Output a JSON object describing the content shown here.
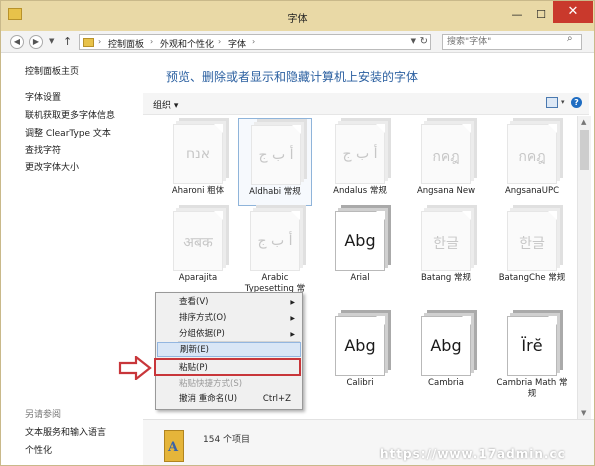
{
  "window": {
    "title": "字体",
    "controls": {
      "minimize": "—",
      "maximize": "☐",
      "close": "✕"
    }
  },
  "address": {
    "crumbs": [
      "控制面板",
      "外观和个性化",
      "字体"
    ],
    "separator": "›",
    "search_placeholder": "搜索\"字体\""
  },
  "sidebar": {
    "home": "控制面板主页",
    "links": [
      "字体设置",
      "联机获取更多字体信息",
      "调整 ClearType 文本",
      "查找字符",
      "更改字体大小"
    ],
    "see_also_title": "另请参阅",
    "see_also": [
      "文本服务和输入语言",
      "个性化"
    ]
  },
  "main": {
    "heading": "预览、删除或者显示和隐藏计算机上安装的字体",
    "organize": "组织",
    "fonts": [
      {
        "name": "Aharoni 粗体",
        "sample": "אנח",
        "style": "light",
        "selected": false
      },
      {
        "name": "Aldhabi 常规",
        "sample": "أ ب ج",
        "style": "light",
        "selected": true
      },
      {
        "name": "Andalus 常规",
        "sample": "أ ب ج",
        "style": "light",
        "selected": false
      },
      {
        "name": "Angsana New",
        "sample": "กคฎ",
        "style": "light",
        "selected": false
      },
      {
        "name": "AngsanaUPC",
        "sample": "กคฎ",
        "style": "light",
        "selected": false
      },
      {
        "name": "Aparajita",
        "sample": "अबक",
        "style": "light",
        "selected": false
      },
      {
        "name": "Arabic Typesetting 常",
        "sample": "أ ب ج",
        "style": "light",
        "selected": false
      },
      {
        "name": "Arial",
        "sample": "Abg",
        "style": "dark",
        "selected": false
      },
      {
        "name": "Batang 常规",
        "sample": "한글",
        "style": "light",
        "selected": false
      },
      {
        "name": "BatangChe 常规",
        "sample": "한글",
        "style": "light",
        "selected": false
      },
      {
        "name": "Calibri",
        "sample": "Abg",
        "style": "dark",
        "selected": false
      },
      {
        "name": "Cambria",
        "sample": "Abg",
        "style": "dark",
        "selected": false
      },
      {
        "name": "Cambria Math 常规",
        "sample": "Ïrĕ",
        "style": "dark",
        "selected": false
      }
    ]
  },
  "context_menu": {
    "items": [
      {
        "label": "查看(V)",
        "submenu": true,
        "highlight": false,
        "disabled": false,
        "shortcut": ""
      },
      {
        "label": "排序方式(O)",
        "submenu": true,
        "highlight": false,
        "disabled": false,
        "shortcut": ""
      },
      {
        "label": "分组依据(P)",
        "submenu": true,
        "highlight": false,
        "disabled": false,
        "shortcut": ""
      },
      {
        "label": "刷新(E)",
        "submenu": false,
        "highlight": true,
        "disabled": false,
        "shortcut": ""
      },
      {
        "label": "粘贴(P)",
        "submenu": false,
        "highlight": false,
        "disabled": false,
        "shortcut": ""
      },
      {
        "label": "粘贴快捷方式(S)",
        "submenu": false,
        "highlight": false,
        "disabled": true,
        "shortcut": ""
      },
      {
        "label": "撤消 重命名(U)",
        "submenu": false,
        "highlight": false,
        "disabled": false,
        "shortcut": "Ctrl+Z"
      }
    ]
  },
  "status": {
    "count": "154 个项目"
  },
  "watermark": "https://www.17admin.cc",
  "colors": {
    "accent": "#2a5fa0",
    "annotation": "#c8363a",
    "titlebar": "#e9d9a6"
  }
}
